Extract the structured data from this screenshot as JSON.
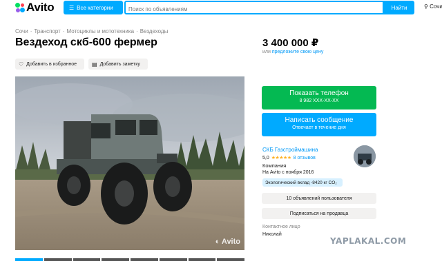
{
  "header": {
    "logo_text": "Avito",
    "categories_label": "Все категории",
    "search_placeholder": "Поиск по объявлениям",
    "search_button": "Найти",
    "location": "Сочи"
  },
  "breadcrumbs": [
    "Сочи",
    "Транспорт",
    "Мотоциклы и мототехника",
    "Вездеходы"
  ],
  "listing": {
    "title": "Вездеход скб-600 фермер",
    "favorite_label": "Добавить в избранное",
    "note_label": "Добавить заметку",
    "photo_watermark": "Avito",
    "thumbnail_count": 8
  },
  "price": {
    "value": "3 400 000 ₽",
    "offer_prefix": "или",
    "offer_link": "предложите свою цену"
  },
  "actions": {
    "phone_title": "Показать телефон",
    "phone_masked": "8 982 XXX-XX-XX",
    "message_title": "Написать сообщение",
    "message_subtitle": "Отвечает в течение дня"
  },
  "seller": {
    "name": "СКБ Газстроймашина",
    "rating": "5,0",
    "stars": "★★★★★",
    "reviews": "8 отзывов",
    "type": "Компания",
    "since": "На Avito с ноября 2016",
    "eco_badge": "Экологический вклад -8420 кг CO₂",
    "ads_button": "10 объявлений пользователя",
    "subscribe_button": "Подписаться на продавца",
    "contact_label": "Контактное лицо",
    "contact_name": "Николай"
  },
  "watermark": "YAPLAKAL.COM",
  "colors": {
    "accent": "#00aaff",
    "phone_green": "#04b952",
    "link": "#0099f7",
    "muted": "#838383",
    "button_grey": "#f2f1f0"
  }
}
